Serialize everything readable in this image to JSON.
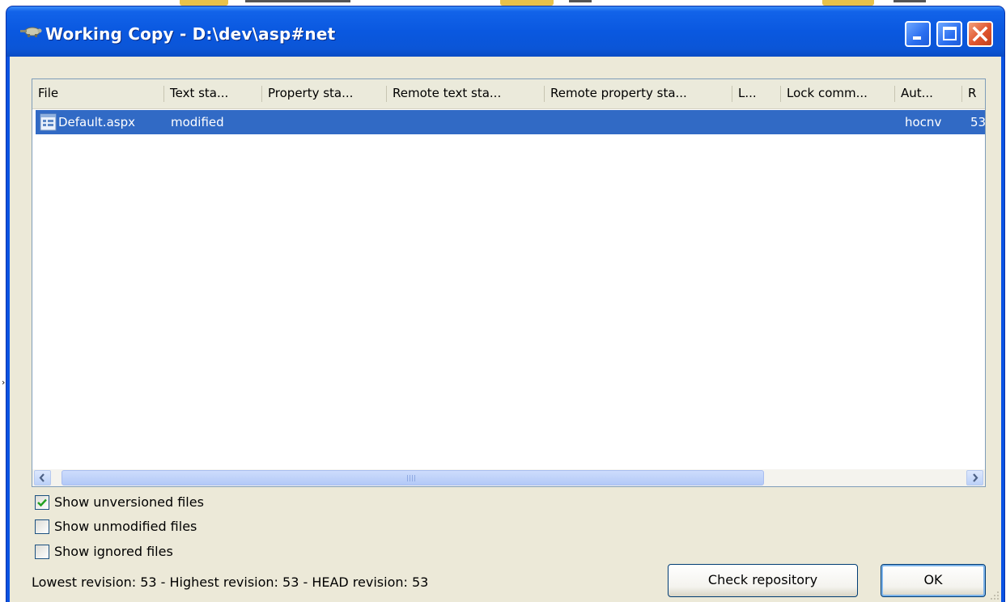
{
  "window": {
    "title": "Working Copy - D:\\dev\\asp#net",
    "title_icon": "tortoise-icon",
    "controls": [
      "minimize-icon",
      "maximize-icon",
      "close-icon"
    ]
  },
  "list": {
    "columns": [
      "File",
      "Text sta...",
      "Property sta...",
      "Remote text sta...",
      "Remote property sta...",
      "L...",
      "Lock comm...",
      "Aut...",
      "R"
    ],
    "rows": [
      {
        "icon": "aspx-file-icon",
        "file": "Default.aspx",
        "text_status": "modified",
        "author": "hocnv",
        "revision": "53"
      }
    ],
    "selected_row": 0
  },
  "options": [
    {
      "label": "Show unversioned files",
      "checked": true
    },
    {
      "label": "Show unmodified files",
      "checked": false
    },
    {
      "label": "Show ignored files",
      "checked": false
    }
  ],
  "status": "Lowest revision: 53 - Highest revision: 53 - HEAD revision: 53",
  "buttons": {
    "check_repository": "Check repository",
    "ok": "OK"
  },
  "colors": {
    "titlebar": "#0a58e0",
    "selection": "#316ac5",
    "dialog_bg": "#ece9d8",
    "close_button": "#e0552e"
  }
}
